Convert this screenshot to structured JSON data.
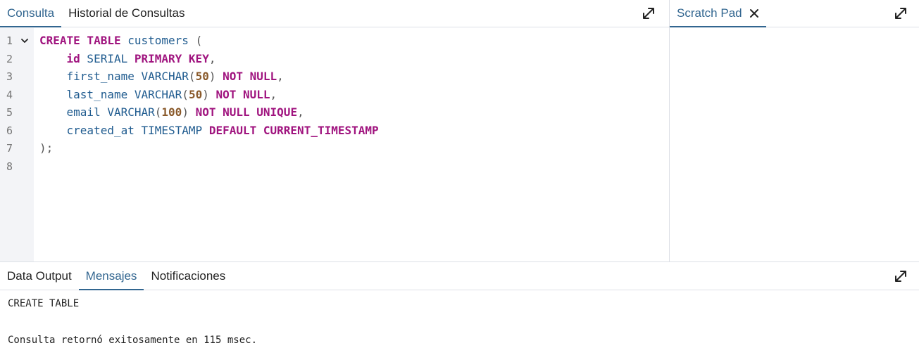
{
  "query_panel": {
    "tabs": [
      {
        "label": "Consulta",
        "active": true
      },
      {
        "label": "Historial de Consultas",
        "active": false
      }
    ],
    "expand_icon": "expand-icon"
  },
  "scratch_panel": {
    "tab_label": "Scratch Pad",
    "close_icon": "close-icon",
    "expand_icon": "expand-icon"
  },
  "editor": {
    "line_numbers": [
      "1",
      "2",
      "3",
      "4",
      "5",
      "6",
      "7",
      "8"
    ],
    "fold_icon": "chevron-down-icon",
    "lines": [
      [
        {
          "t": "kw",
          "v": "CREATE TABLE"
        },
        {
          "t": "id",
          "v": " customers "
        },
        {
          "t": "punc",
          "v": "("
        }
      ],
      [
        {
          "t": "id",
          "v": "    "
        },
        {
          "t": "kw",
          "v": "id"
        },
        {
          "t": "id",
          "v": " SERIAL "
        },
        {
          "t": "kw",
          "v": "PRIMARY KEY"
        },
        {
          "t": "punc",
          "v": ","
        }
      ],
      [
        {
          "t": "id",
          "v": "    first_name VARCHAR"
        },
        {
          "t": "punc",
          "v": "("
        },
        {
          "t": "num",
          "v": "50"
        },
        {
          "t": "punc",
          "v": ") "
        },
        {
          "t": "kw",
          "v": "NOT NULL"
        },
        {
          "t": "punc",
          "v": ","
        }
      ],
      [
        {
          "t": "id",
          "v": "    last_name VARCHAR"
        },
        {
          "t": "punc",
          "v": "("
        },
        {
          "t": "num",
          "v": "50"
        },
        {
          "t": "punc",
          "v": ") "
        },
        {
          "t": "kw",
          "v": "NOT NULL"
        },
        {
          "t": "punc",
          "v": ","
        }
      ],
      [
        {
          "t": "id",
          "v": "    email VARCHAR"
        },
        {
          "t": "punc",
          "v": "("
        },
        {
          "t": "num",
          "v": "100"
        },
        {
          "t": "punc",
          "v": ") "
        },
        {
          "t": "kw",
          "v": "NOT NULL UNIQUE"
        },
        {
          "t": "punc",
          "v": ","
        }
      ],
      [
        {
          "t": "id",
          "v": "    created_at TIMESTAMP "
        },
        {
          "t": "kw",
          "v": "DEFAULT CURRENT_TIMESTAMP"
        }
      ],
      [
        {
          "t": "punc",
          "v": ");"
        }
      ],
      []
    ]
  },
  "output_panel": {
    "tabs": [
      {
        "label": "Data Output",
        "active": false
      },
      {
        "label": "Mensajes",
        "active": true
      },
      {
        "label": "Notificaciones",
        "active": false
      }
    ],
    "expand_icon": "expand-icon",
    "messages": [
      "CREATE TABLE",
      "",
      "Consulta retornó exitosamente en 115 msec."
    ]
  },
  "colors": {
    "accent": "#326690",
    "keyword": "#a0147f",
    "identifier": "#1f5b8f",
    "number": "#8a5a2b",
    "gutter_bg": "#f3f4f7",
    "divider": "#dde0e6"
  }
}
